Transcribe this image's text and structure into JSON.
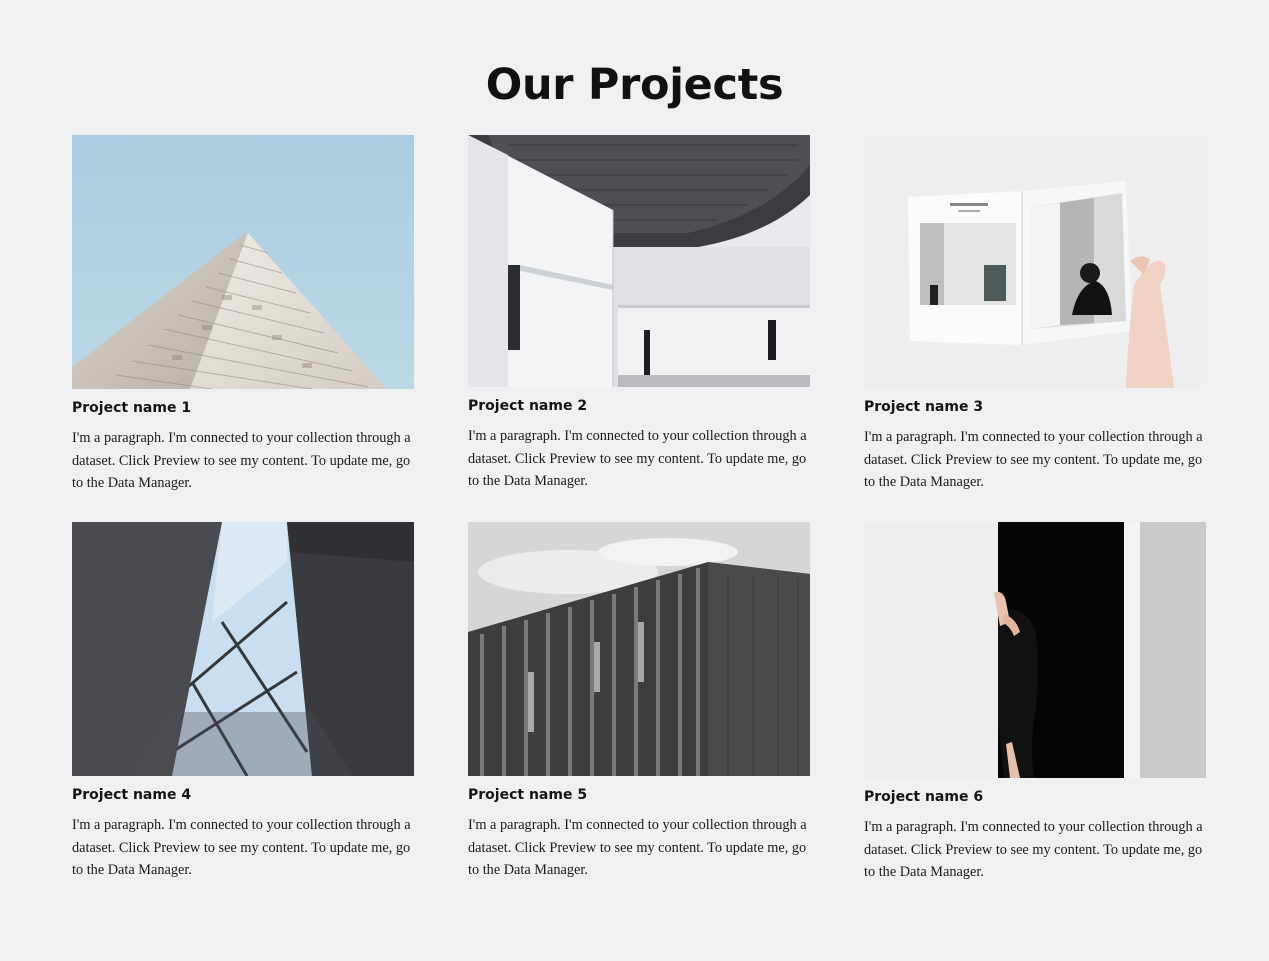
{
  "page": {
    "title": "Our Projects",
    "background": "#eff0f2"
  },
  "projects": [
    {
      "name": "Project name 1",
      "description": "I'm a paragraph. I'm connected to your collection through a dataset. Click Preview to see my content. To update me, go to the Data Manager.",
      "image": "pyramid-building-against-blue-sky"
    },
    {
      "name": "Project name 2",
      "description": "I'm a paragraph. I'm connected to your collection through a dataset. Click Preview to see my content. To update me, go to the Data Manager.",
      "image": "white-building-with-dome-canopy"
    },
    {
      "name": "Project name 3",
      "description": "I'm a paragraph. I'm connected to your collection through a dataset. Click Preview to see my content. To update me, go to the Data Manager.",
      "image": "hand-holding-open-magazine"
    },
    {
      "name": "Project name 4",
      "description": "I'm a paragraph. I'm connected to your collection through a dataset. Click Preview to see my content. To update me, go to the Data Manager.",
      "image": "skylight-between-dark-walls"
    },
    {
      "name": "Project name 5",
      "description": "I'm a paragraph. I'm connected to your collection through a dataset. Click Preview to see my content. To update me, go to the Data Manager.",
      "image": "timber-facade-building"
    },
    {
      "name": "Project name 6",
      "description": "I'm a paragraph. I'm connected to your collection through a dataset. Click Preview to see my content. To update me, go to the Data Manager.",
      "image": "person-at-black-doorway"
    }
  ]
}
